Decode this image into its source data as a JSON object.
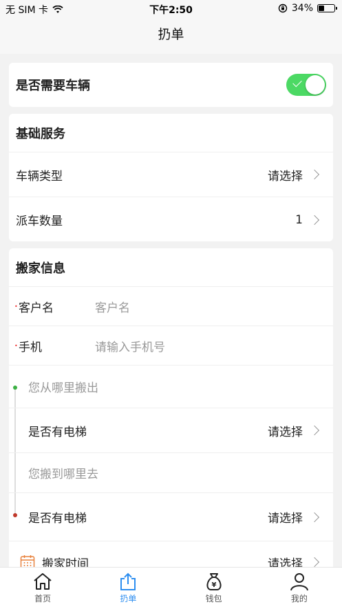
{
  "status_bar": {
    "carrier": "无 SIM 卡",
    "time": "下午2:50",
    "battery": "34%"
  },
  "nav": {
    "title": "扔单"
  },
  "vehicle_card": {
    "label": "是否需要车辆",
    "toggle_on": true
  },
  "basic_service": {
    "title": "基础服务",
    "vehicle_type_label": "车辆类型",
    "vehicle_type_value": "请选择",
    "dispatch_count_label": "派车数量",
    "dispatch_count_value": "1"
  },
  "moving_info": {
    "title": "搬家信息",
    "customer_label": "客户名",
    "customer_placeholder": "客户名",
    "phone_label": "手机",
    "phone_placeholder": "请输入手机号",
    "from_placeholder": "您从哪里搬出",
    "from_elevator_label": "是否有电梯",
    "from_elevator_value": "请选择",
    "to_placeholder": "您搬到哪里去",
    "to_elevator_label": "是否有电梯",
    "to_elevator_value": "请选择",
    "time_label": "搬家时间",
    "time_value": "请选择"
  },
  "tab_bar": {
    "items": [
      {
        "label": "首页",
        "icon": "home-icon"
      },
      {
        "label": "扔单",
        "icon": "share-icon"
      },
      {
        "label": "钱包",
        "icon": "wallet-icon"
      },
      {
        "label": "我的",
        "icon": "user-icon"
      }
    ],
    "active_index": 1
  },
  "colors": {
    "toggle_on": "#4cd964",
    "tab_active": "#2d8ef0",
    "required_marker": "#e33333",
    "from_dot": "#3cb043",
    "to_dot": "#c0392b",
    "calendar_icon": "#e8803a"
  }
}
